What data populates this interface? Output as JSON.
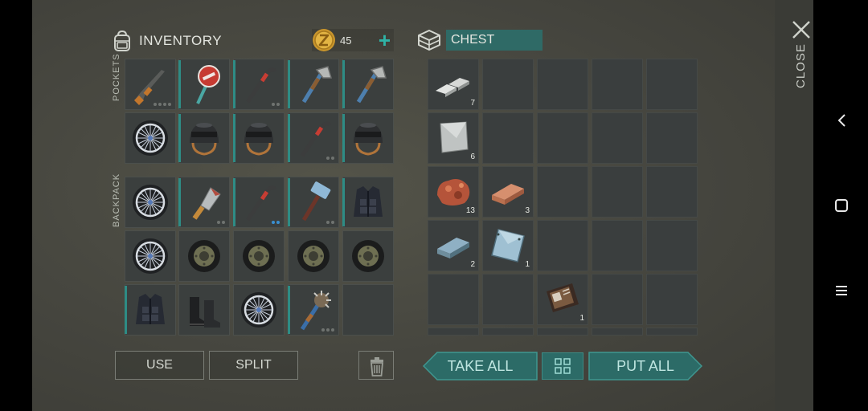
{
  "inventory": {
    "title": "INVENTORY",
    "coins": "45",
    "add_coins_label": "+",
    "pockets_label": "POCKETS",
    "backpack_label": "BACKPACK",
    "pockets_items": [
      {
        "icon": "rifle-icon"
      },
      {
        "icon": "stop-sign-icon"
      },
      {
        "icon": "crowbar-icon"
      },
      {
        "icon": "hatchet-icon"
      },
      {
        "icon": "hatchet-icon"
      },
      {
        "icon": "wheel-icon"
      },
      {
        "icon": "helmet-icon"
      },
      {
        "icon": "helmet-icon"
      },
      {
        "icon": "crowbar-icon"
      },
      {
        "icon": "helmet-icon"
      }
    ],
    "backpack_items": [
      {
        "icon": "wheel-icon"
      },
      {
        "icon": "cleaver-icon"
      },
      {
        "icon": "crowbar-icon"
      },
      {
        "icon": "sledgehammer-icon"
      },
      {
        "icon": "vest-icon"
      },
      {
        "icon": "wheel-icon"
      },
      {
        "icon": "tire-icon"
      },
      {
        "icon": "tire-icon"
      },
      {
        "icon": "tire-icon"
      },
      {
        "icon": "tire-icon"
      },
      {
        "icon": "vest-icon"
      },
      {
        "icon": "boots-icon"
      },
      {
        "icon": "wheel-icon"
      },
      {
        "icon": "spiked-club-icon"
      },
      {
        "icon": ""
      }
    ]
  },
  "chest": {
    "title": "CHEST",
    "items": [
      {
        "icon": "metal-bars-icon",
        "qty": "7"
      },
      {
        "icon": "metal-sheet-icon",
        "qty": "6"
      },
      {
        "icon": "copper-ore-icon",
        "qty": "13"
      },
      {
        "icon": "copper-ingot-icon",
        "qty": "3"
      },
      {
        "icon": "iron-ingot-icon",
        "qty": "2"
      },
      {
        "icon": "steel-plate-icon",
        "qty": "1"
      },
      {
        "icon": "notebook-icon",
        "qty": "1"
      }
    ]
  },
  "buttons": {
    "use": "USE",
    "split": "SPLIT",
    "take_all": "TAKE ALL",
    "put_all": "PUT ALL",
    "close": "CLOSE"
  },
  "colors": {
    "accent": "#2e8c85",
    "teal_button": "#2c6b67",
    "background": "#4a4a42"
  }
}
